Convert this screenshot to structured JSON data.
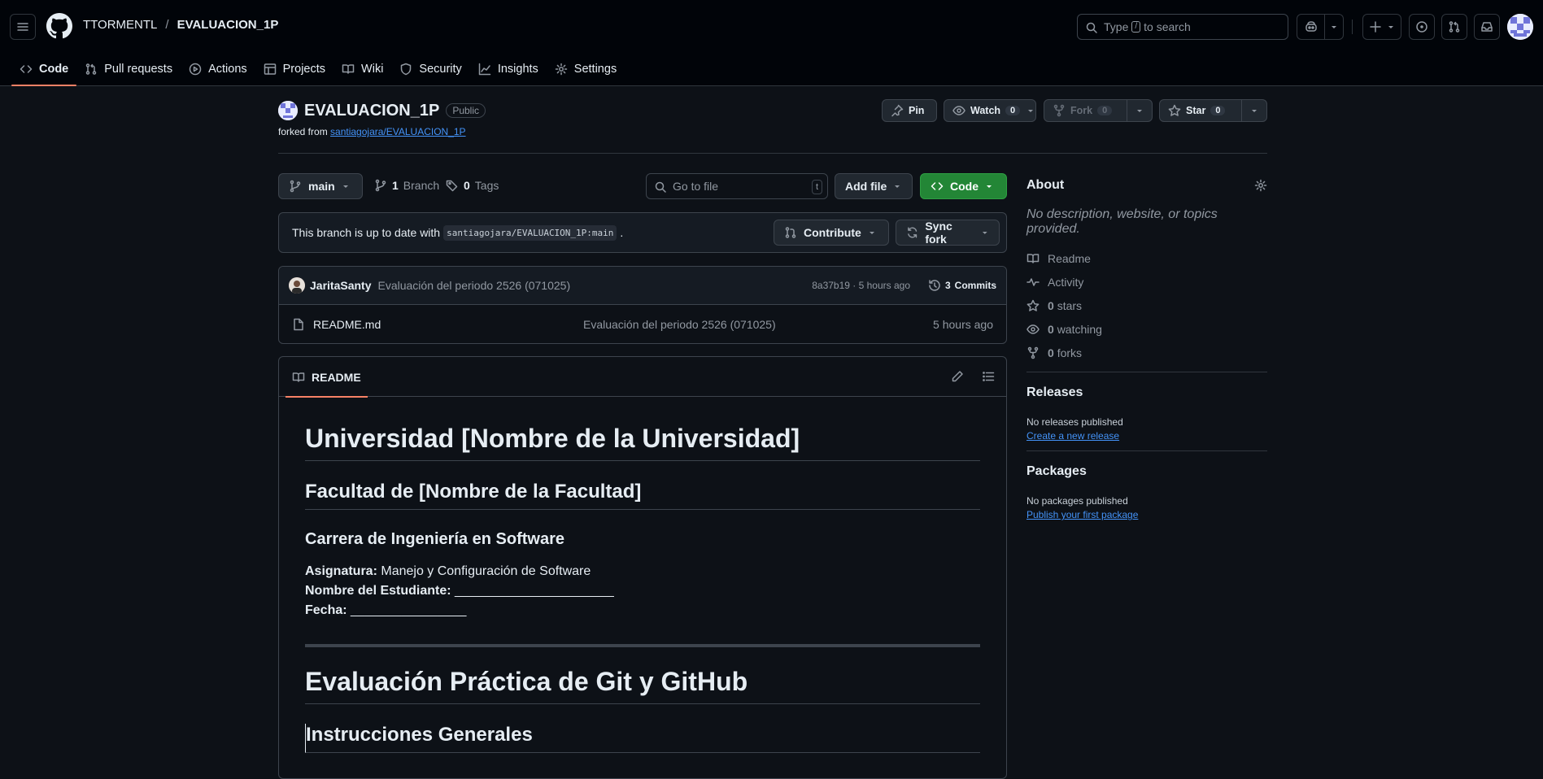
{
  "header": {
    "owner": "TTORMENTL",
    "separator": "/",
    "repo": "EVALUACION_1P",
    "search_text_before": "Type",
    "search_key": "/",
    "search_text_after": "to search"
  },
  "nav_tabs": [
    {
      "label": "Code",
      "icon": "code-icon"
    },
    {
      "label": "Pull requests",
      "icon": "git-pull-request-icon"
    },
    {
      "label": "Actions",
      "icon": "play-icon"
    },
    {
      "label": "Projects",
      "icon": "table-icon"
    },
    {
      "label": "Wiki",
      "icon": "book-icon"
    },
    {
      "label": "Security",
      "icon": "shield-icon"
    },
    {
      "label": "Insights",
      "icon": "graph-icon"
    },
    {
      "label": "Settings",
      "icon": "gear-icon"
    }
  ],
  "repo": {
    "name": "EVALUACION_1P",
    "visibility": "Public",
    "forked_prefix": "forked from",
    "forked_from": "santiagojara/EVALUACION_1P",
    "pin_label": "Pin",
    "watch_label": "Watch",
    "watch_count": "0",
    "fork_label": "Fork",
    "fork_count": "0",
    "star_label": "Star",
    "star_count": "0"
  },
  "file_nav": {
    "branch": "main",
    "branches_count": "1",
    "branches_label": "Branch",
    "tags_count": "0",
    "tags_label": "Tags",
    "go_to_file_placeholder": "Go to file",
    "go_to_file_key": "t",
    "add_file_label": "Add file",
    "code_label": "Code"
  },
  "branch_status": {
    "text": "This branch is up to date with",
    "ref": "santiagojara/EVALUACION_1P:main",
    "period": ".",
    "contribute_label": "Contribute",
    "sync_label": "Sync fork"
  },
  "latest_commit": {
    "author": "JaritaSanty",
    "message": "Evaluación del periodo 2526 (071025)",
    "hash_time": "8a37b19 · 5 hours ago",
    "commits_count": "3",
    "commits_label": "Commits"
  },
  "files": [
    {
      "name": "README.md",
      "message": "Evaluación del periodo 2526 (071025)",
      "time": "5 hours ago"
    }
  ],
  "readme": {
    "tab_label": "README",
    "h1": "Universidad [Nombre de la Universidad]",
    "h2": "Facultad de [Nombre de la Facultad]",
    "h3": "Carrera de Ingeniería en Software",
    "asignatura_label": "Asignatura:",
    "asignatura_value": "Manejo y Configuración de Software",
    "estudiante_label": "Nombre del Estudiante:",
    "estudiante_value": "______________________",
    "fecha_label": "Fecha:",
    "fecha_value": "________________",
    "h1b": "Evaluación Práctica de Git y GitHub",
    "h2b": "Instrucciones Generales"
  },
  "sidebar": {
    "about_title": "About",
    "about_desc": "No description, website, or topics provided.",
    "readme_link": "Readme",
    "activity_link": "Activity",
    "stars_count": "0",
    "stars_label": "stars",
    "watching_count": "0",
    "watching_label": "watching",
    "forks_count": "0",
    "forks_label": "forks",
    "releases_title": "Releases",
    "releases_text": "No releases published",
    "releases_link": "Create a new release",
    "packages_title": "Packages",
    "packages_text": "No packages published",
    "packages_link": "Publish your first package"
  },
  "colors": {
    "accent_underline": "#f78166",
    "link": "#4493f8",
    "code_button": "#238636",
    "background": "#0d1117"
  }
}
